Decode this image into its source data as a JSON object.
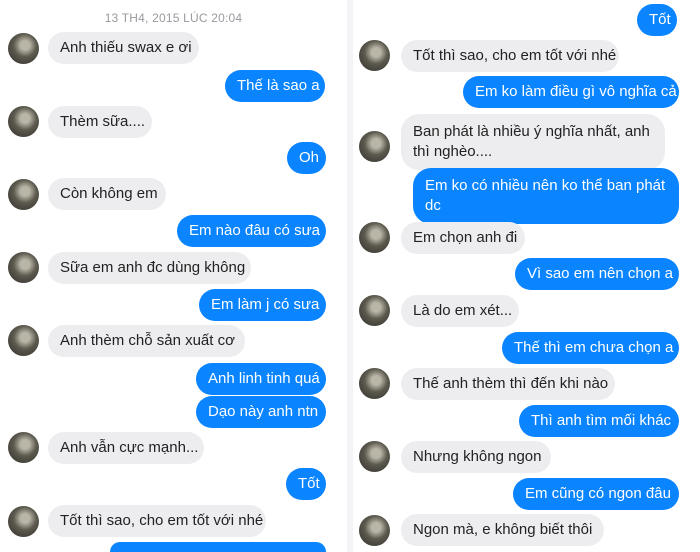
{
  "left": {
    "timestamp": "13 TH4, 2015 LÚC 20:04",
    "messages": [
      {
        "dir": "in",
        "text": "Anh thiếu swax e ơi"
      },
      {
        "dir": "out",
        "text": "Thế là sao a"
      },
      {
        "dir": "in",
        "text": "Thèm sữa...."
      },
      {
        "dir": "out",
        "text": "Oh"
      },
      {
        "dir": "in",
        "text": "Còn không em"
      },
      {
        "dir": "out",
        "text": "Em nào đâu có sưa"
      },
      {
        "dir": "in",
        "text": "Sữa em anh đc dùng không"
      },
      {
        "dir": "out",
        "text": "Em làm j có sưa"
      },
      {
        "dir": "in",
        "text": "Anh thèm chỗ sản xuất cơ"
      },
      {
        "dir": "out",
        "text": "Anh linh tinh quá"
      },
      {
        "dir": "out",
        "text": "Dạo này anh ntn"
      },
      {
        "dir": "in",
        "text": "Anh vẫn cực mạnh..."
      },
      {
        "dir": "out",
        "text": "Tốt"
      },
      {
        "dir": "in",
        "text": "Tốt thì sao, cho em tốt với nhé"
      }
    ]
  },
  "right": {
    "messages": [
      {
        "dir": "out",
        "text": "Tốt"
      },
      {
        "dir": "in",
        "text": "Tốt thì sao, cho em tốt với nhé"
      },
      {
        "dir": "out",
        "text": "Em ko làm điều gì vô nghĩa cả"
      },
      {
        "dir": "in",
        "text": "Ban phát là nhiều ý nghĩa nhất, anh thì nghèo...."
      },
      {
        "dir": "out",
        "text": "Em ko có nhiều nên ko thể ban phát dc"
      },
      {
        "dir": "in",
        "text": "Em chọn anh đi"
      },
      {
        "dir": "out",
        "text": "Vì sao em nên chọn a"
      },
      {
        "dir": "in",
        "text": "Là do em xét..."
      },
      {
        "dir": "out",
        "text": "Thế thì em chưa chọn a"
      },
      {
        "dir": "in",
        "text": "Thế anh thèm thì đến khi nào"
      },
      {
        "dir": "out",
        "text": "Thì anh tìm mối khác"
      },
      {
        "dir": "in",
        "text": "Nhưng không ngon"
      },
      {
        "dir": "out",
        "text": "Em cũng có ngon đâu"
      },
      {
        "dir": "in",
        "text": "Ngon mà, e không biết thôi"
      }
    ]
  }
}
